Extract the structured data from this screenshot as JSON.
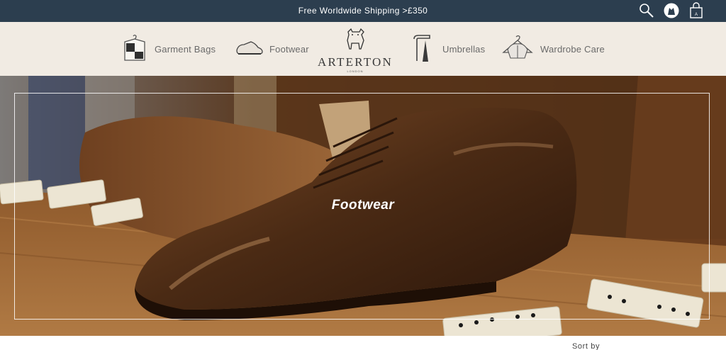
{
  "topbar": {
    "shipping_text": "Free Worldwide Shipping >£350",
    "icons": [
      "search-icon",
      "account-icon",
      "shopping-bag-icon"
    ]
  },
  "nav": {
    "items": [
      {
        "label": "Garment Bags",
        "icon": "garment-bag-icon"
      },
      {
        "label": "Footwear",
        "icon": "shoe-icon"
      },
      {
        "label": "Umbrellas",
        "icon": "umbrella-icon"
      },
      {
        "label": "Wardrobe Care",
        "icon": "hanger-icon"
      }
    ],
    "logo": {
      "brand": "ARTERTON",
      "sub": "LONDON",
      "icon": "dog-logo-icon"
    }
  },
  "hero": {
    "title": "Footwear"
  },
  "sort": {
    "label": "Sort by"
  },
  "colors": {
    "topbar": "#2c3e4f",
    "nav_bg": "#f1ebe3",
    "nav_text": "#6a6a6a"
  }
}
